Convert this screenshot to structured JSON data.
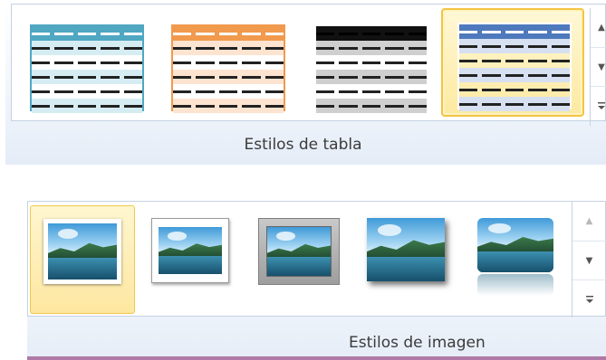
{
  "table_styles": {
    "group_label": "Estilos de tabla",
    "styles": [
      {
        "name": "style-1",
        "header_color": "#4fa7c2",
        "line_color": "#222222",
        "band_color": "#d6ecf3",
        "border_color": "#4fa7c2",
        "selected": false
      },
      {
        "name": "style-2",
        "header_color": "#f19a4e",
        "line_color": "#222222",
        "band_color": "#fde4d0",
        "border_color": "#f19a4e",
        "selected": false
      },
      {
        "name": "style-3",
        "header_color": "#111111",
        "line_color": "#222222",
        "band_color": "#cfcfcf",
        "border_color": "#ffffff",
        "selected": false
      },
      {
        "name": "style-4",
        "header_color": "#4f79bd",
        "line_color": "#222222",
        "band_color": "#d6e0f0",
        "border_color": "#ffffff",
        "selected": true
      }
    ],
    "scroll_icons": [
      "scroll-up-icon",
      "scroll-down-icon",
      "more-icon"
    ]
  },
  "picture_styles": {
    "group_label": "Estilos de imagen",
    "styles": [
      {
        "name": "simple-white-frame",
        "selected": true
      },
      {
        "name": "shadow-frame",
        "selected": false
      },
      {
        "name": "metal-frame",
        "selected": false
      },
      {
        "name": "drop-shadow-rectangle",
        "selected": false
      },
      {
        "name": "reflected-rounded-rectangle",
        "selected": false
      }
    ],
    "scroll_icons": [
      "scroll-up-icon",
      "scroll-down-icon",
      "more-icon"
    ],
    "accent_bar_color": "#b07aa6"
  }
}
